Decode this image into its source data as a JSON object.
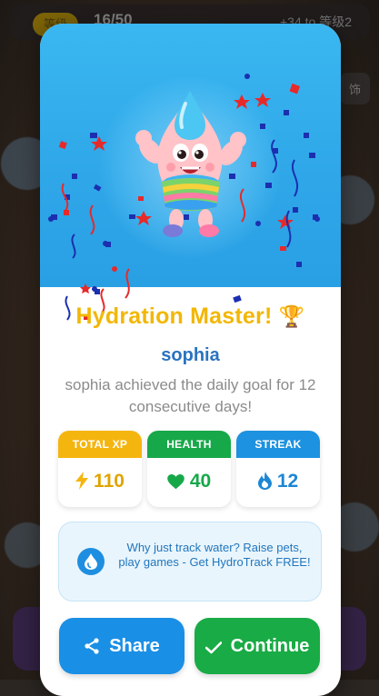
{
  "background": {
    "level_badge": "等级",
    "progress_count": "16/50",
    "xp_hint": "+34 to 等级2",
    "deco_button": "饰"
  },
  "modal": {
    "title": "Hydration Master!",
    "trophy": "🏆",
    "username": "sophia",
    "description": "sophia achieved the daily goal for 12 consecutive days!",
    "stats": [
      {
        "label": "TOTAL XP",
        "value": "110",
        "icon": "lightning-icon",
        "color": "#f5b50f"
      },
      {
        "label": "HEALTH",
        "value": "40",
        "icon": "heart-icon",
        "color": "#17a84a"
      },
      {
        "label": "STREAK",
        "value": "12",
        "icon": "flame-icon",
        "color": "#1d92e0"
      }
    ],
    "promo_text": "Why just track water? Raise pets, play games - Get HydroTrack FREE!",
    "promo_icon": "water-drop-icon",
    "share_label": "Share",
    "continue_label": "Continue"
  },
  "colors": {
    "hero_sky": "#2ea6e8",
    "title_gold": "#f2b705",
    "username_blue": "#2a73bf",
    "share_blue": "#1a8fe6",
    "continue_green": "#19ab45"
  }
}
